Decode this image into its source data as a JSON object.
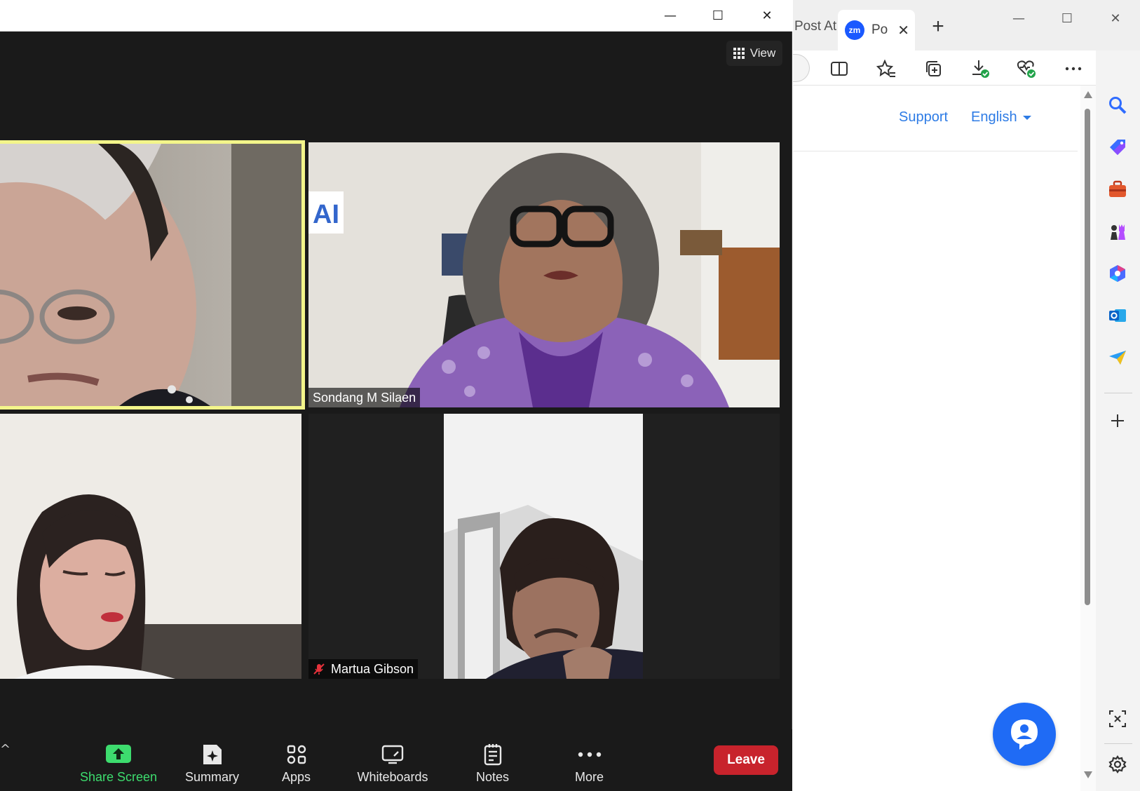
{
  "zoom": {
    "window_controls": {
      "minimize": "—",
      "maximize": "☐",
      "close": "✕"
    },
    "view_label": "View",
    "participants": [
      {
        "name": "",
        "active_speaker": true
      },
      {
        "name": "Sondang M Silaen",
        "active_speaker": false
      },
      {
        "name": "",
        "active_speaker": false
      },
      {
        "name": "Martua Gibson",
        "muted": true,
        "active_speaker": false
      }
    ],
    "toolbar": {
      "caret": "^",
      "share_screen": "Share Screen",
      "summary": "Summary",
      "apps": "Apps",
      "whiteboards": "Whiteboards",
      "notes": "Notes",
      "more": "More",
      "leave": "Leave"
    },
    "colors": {
      "active_speaker_border": "#f3f58a",
      "share_green": "#3ddc6e",
      "leave_red": "#c8232c"
    }
  },
  "edge": {
    "tab_inactive_title": "Post At",
    "tab_active_favicon": "zm",
    "tab_active_title": "Po",
    "tab_close": "✕",
    "new_tab": "+",
    "window_controls": {
      "minimize": "—",
      "maximize": "☐",
      "close": "✕"
    },
    "page": {
      "support": "Support",
      "language": "English"
    },
    "sidebar_icons": [
      "search-icon",
      "tag-icon",
      "toolbox-icon",
      "chess-icon",
      "office-icon",
      "outlook-icon",
      "send-icon",
      "add-icon",
      "screenshot-icon",
      "settings-icon"
    ],
    "colors": {
      "link_blue": "#2d7be5",
      "fab_blue": "#1f6bf5"
    }
  }
}
